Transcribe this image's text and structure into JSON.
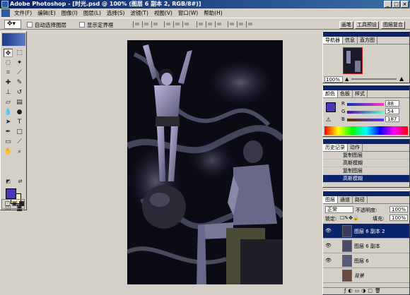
{
  "window": {
    "app_name": "Adobe Photoshop",
    "document_title": "Adobe Photoshop - [时光.psd @ 100% (图层 6 副本 2, RGB/8#)]",
    "minimize": "_",
    "maximize": "□",
    "close": "×"
  },
  "menu": [
    "文件(F)",
    "编辑(E)",
    "图像(I)",
    "图层(L)",
    "选择(S)",
    "滤镜(T)",
    "视图(V)",
    "窗口(W)",
    "帮助(H)"
  ],
  "options": {
    "auto_select_label": "自动选择图层",
    "show_bounds_label": "显示定界框",
    "tabs": [
      "画笔",
      "工具预设",
      "图层复合"
    ]
  },
  "colors": {
    "foreground": "#4a38b8",
    "background": "#f8eab8",
    "accent": "#0a246a"
  },
  "navigator": {
    "tabs": [
      "导航器",
      "信息",
      "直方图"
    ],
    "zoom": "100%"
  },
  "color_panel": {
    "tabs": [
      "颜色",
      "色板",
      "样式"
    ],
    "r_label": "R",
    "g_label": "G",
    "b_label": "B",
    "r": "88",
    "g": "54",
    "b": "187"
  },
  "history": {
    "tabs": [
      "历史记录",
      "动作"
    ],
    "items": [
      "复制图层",
      "高斯模糊",
      "复制图层",
      "高斯模糊"
    ],
    "active_index": 3
  },
  "layers": {
    "tabs": [
      "图层",
      "通道",
      "路径"
    ],
    "blend_mode": "正常",
    "opacity_label": "不透明度:",
    "opacity": "100%",
    "lock_label": "锁定:",
    "fill_label": "填充:",
    "fill": "100%",
    "items": [
      {
        "name": "图层 6 副本 2",
        "active": true
      },
      {
        "name": "图层 6 副本",
        "active": false
      },
      {
        "name": "图层 6",
        "active": false
      },
      {
        "name": "背景",
        "active": false
      }
    ]
  }
}
